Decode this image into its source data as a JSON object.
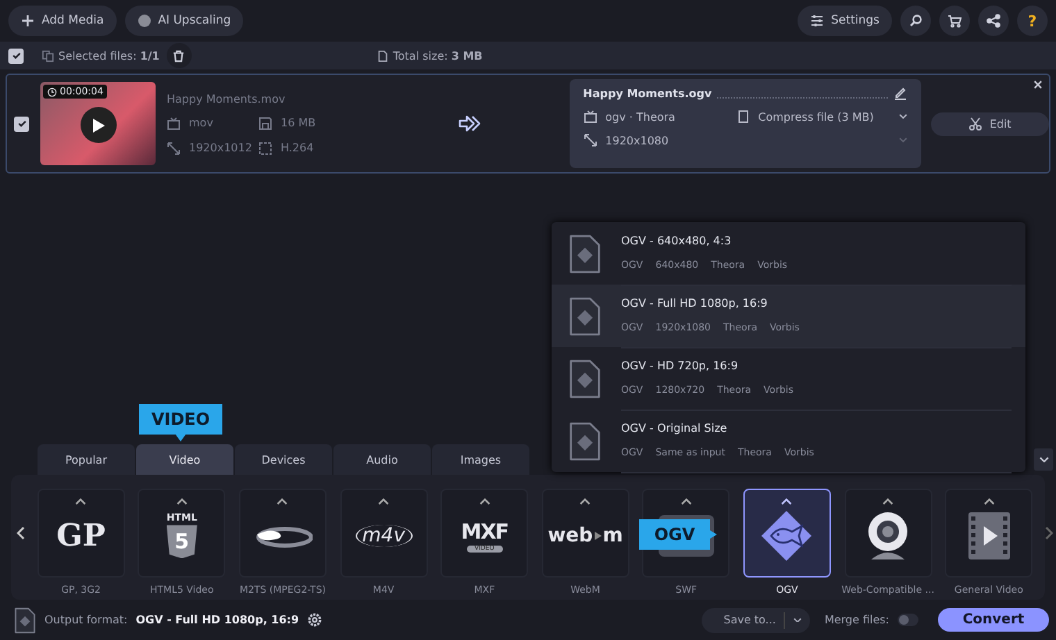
{
  "toolbar": {
    "add_media": "Add Media",
    "ai_upscaling": "AI Upscaling",
    "settings": "Settings",
    "help": "?"
  },
  "selection_bar": {
    "checked": true,
    "selected": "Selected files: **1/1**",
    "total": "Total size: **3 MB**"
  },
  "file": {
    "checked": true,
    "duration": "00:00:04",
    "name": "Happy Moments.mov",
    "format": "mov",
    "size": "16 MB",
    "resolution": "1920x1012",
    "codec": "H.264"
  },
  "output": {
    "name": "Happy Moments.ogv",
    "format": "ogv · Theora",
    "compress": "Compress file (3 MB)",
    "resolution": "1920x1080",
    "edit": "Edit"
  },
  "presets": [
    {
      "title": "OGV - 640x480, 4:3",
      "details": [
        "OGV",
        "640x480",
        "Theora",
        "Vorbis"
      ],
      "selected": false
    },
    {
      "title": "OGV - Full HD 1080p, 16:9",
      "details": [
        "OGV",
        "1920x1080",
        "Theora",
        "Vorbis"
      ],
      "selected": true
    },
    {
      "title": "OGV - HD 720p, 16:9",
      "details": [
        "OGV",
        "1280x720",
        "Theora",
        "Vorbis"
      ],
      "selected": false
    },
    {
      "title": "OGV - Original Size",
      "details": [
        "OGV",
        "Same as input",
        "Theora",
        "Vorbis"
      ],
      "selected": false
    }
  ],
  "tabs": [
    {
      "label": "Popular",
      "selected": false
    },
    {
      "label": "Video",
      "selected": true
    },
    {
      "label": "Devices",
      "selected": false
    },
    {
      "label": "Audio",
      "selected": false
    },
    {
      "label": "Images",
      "selected": false
    }
  ],
  "tab_tooltip": "VIDEO",
  "tiles": [
    {
      "label": "GP, 3G2",
      "kind": "gp",
      "logo": [
        "GP"
      ],
      "selected": false
    },
    {
      "label": "HTML5 Video",
      "kind": "html5",
      "logo": [
        "HTML",
        "5"
      ],
      "selected": false
    },
    {
      "label": "M2TS (MPEG2-TS)",
      "kind": "bluray",
      "selected": false
    },
    {
      "label": "M4V",
      "kind": "m4v",
      "logo": [
        "m4v"
      ],
      "selected": false
    },
    {
      "label": "MXF",
      "kind": "mxf",
      "logo": [
        "MXF",
        "VIDEO"
      ],
      "selected": false
    },
    {
      "label": "WebM",
      "kind": "webm",
      "logo": [
        "web",
        "m"
      ],
      "selected": false
    },
    {
      "label": "SWF",
      "kind": "swf",
      "selected": false
    },
    {
      "label": "OGV",
      "kind": "ogv",
      "selected": true
    },
    {
      "label": "Web-Compatible ...",
      "kind": "webcam",
      "selected": false
    },
    {
      "label": "General Video",
      "kind": "film",
      "selected": false
    }
  ],
  "tile_tooltip": "OGV",
  "bottom": {
    "output_label": "Output format:",
    "output_value": "OGV - Full HD 1080p, 16:9",
    "save_to": "Save to...",
    "merge_label": "Merge files:",
    "merge_on": false,
    "convert": "Convert"
  }
}
